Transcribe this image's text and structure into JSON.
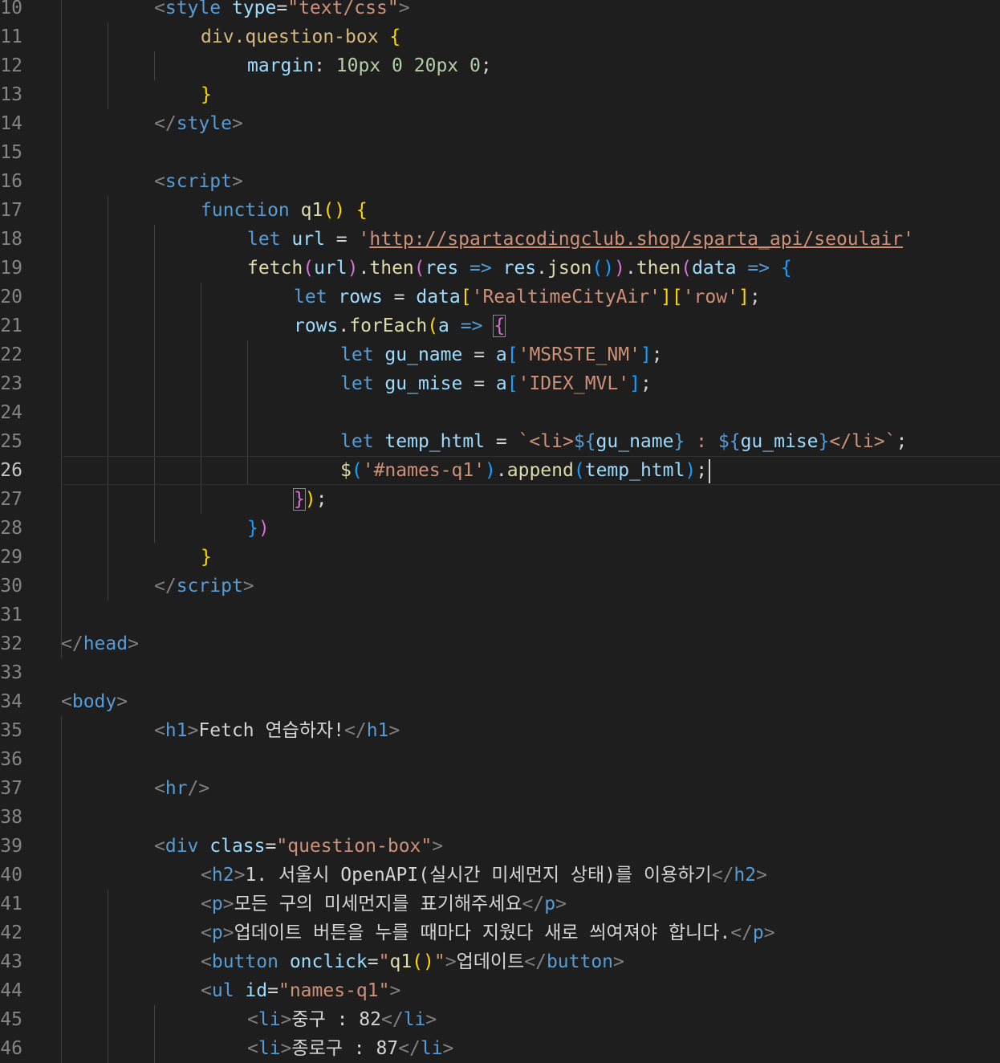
{
  "lines": [
    {
      "n": "10",
      "indent": 2,
      "tokens": [
        [
          "tagb",
          "<"
        ],
        [
          "tag",
          "style"
        ],
        [
          "txt",
          " "
        ],
        [
          "attr",
          "type"
        ],
        [
          "txt",
          "="
        ],
        [
          "str",
          "\"text/css\""
        ],
        [
          "tagb",
          ">"
        ]
      ]
    },
    {
      "n": "11",
      "indent": 3,
      "tokens": [
        [
          "css",
          "div.question-box"
        ],
        [
          "txt",
          " "
        ],
        [
          "p1",
          "{"
        ]
      ]
    },
    {
      "n": "12",
      "indent": 4,
      "tokens": [
        [
          "prop",
          "margin"
        ],
        [
          "txt",
          ": "
        ],
        [
          "num",
          "10px"
        ],
        [
          "txt",
          " "
        ],
        [
          "num",
          "0"
        ],
        [
          "txt",
          " "
        ],
        [
          "num",
          "20px"
        ],
        [
          "txt",
          " "
        ],
        [
          "num",
          "0"
        ],
        [
          "txt",
          ";"
        ]
      ]
    },
    {
      "n": "13",
      "indent": 3,
      "tokens": [
        [
          "p1",
          "}"
        ]
      ]
    },
    {
      "n": "14",
      "indent": 2,
      "tokens": [
        [
          "tagb",
          "</"
        ],
        [
          "tag",
          "style"
        ],
        [
          "tagb",
          ">"
        ]
      ]
    },
    {
      "n": "15",
      "indent": 0,
      "tokens": []
    },
    {
      "n": "16",
      "indent": 2,
      "tokens": [
        [
          "tagb",
          "<"
        ],
        [
          "tag",
          "script"
        ],
        [
          "tagb",
          ">"
        ]
      ]
    },
    {
      "n": "17",
      "indent": 3,
      "tokens": [
        [
          "kw",
          "function"
        ],
        [
          "txt",
          " "
        ],
        [
          "func",
          "q1"
        ],
        [
          "p1",
          "()"
        ],
        [
          "txt",
          " "
        ],
        [
          "p1",
          "{"
        ]
      ]
    },
    {
      "n": "18",
      "indent": 4,
      "tokens": [
        [
          "kw",
          "let"
        ],
        [
          "txt",
          " "
        ],
        [
          "var",
          "url"
        ],
        [
          "txt",
          " = "
        ],
        [
          "str",
          "'"
        ],
        [
          "strlink",
          "http://spartacodingclub.shop/sparta_api/seoulair"
        ],
        [
          "str",
          "'"
        ]
      ]
    },
    {
      "n": "19",
      "indent": 4,
      "tokens": [
        [
          "func",
          "fetch"
        ],
        [
          "p2",
          "("
        ],
        [
          "var",
          "url"
        ],
        [
          "p2",
          ")"
        ],
        [
          "txt",
          "."
        ],
        [
          "func",
          "then"
        ],
        [
          "p2",
          "("
        ],
        [
          "var",
          "res"
        ],
        [
          "txt",
          " "
        ],
        [
          "kw",
          "=>"
        ],
        [
          "txt",
          " "
        ],
        [
          "var",
          "res"
        ],
        [
          "txt",
          "."
        ],
        [
          "func",
          "json"
        ],
        [
          "p3",
          "()"
        ],
        [
          "p2",
          ")"
        ],
        [
          "txt",
          "."
        ],
        [
          "func",
          "then"
        ],
        [
          "p2",
          "("
        ],
        [
          "var",
          "data"
        ],
        [
          "txt",
          " "
        ],
        [
          "kw",
          "=>"
        ],
        [
          "txt",
          " "
        ],
        [
          "p3",
          "{"
        ]
      ]
    },
    {
      "n": "20",
      "indent": 5,
      "tokens": [
        [
          "kw",
          "let"
        ],
        [
          "txt",
          " "
        ],
        [
          "var",
          "rows"
        ],
        [
          "txt",
          " = "
        ],
        [
          "var",
          "data"
        ],
        [
          "p1",
          "["
        ],
        [
          "str",
          "'RealtimeCityAir'"
        ],
        [
          "p1",
          "]["
        ],
        [
          "str",
          "'row'"
        ],
        [
          "p1",
          "]"
        ],
        [
          "txt",
          ";"
        ]
      ]
    },
    {
      "n": "21",
      "indent": 5,
      "tokens": [
        [
          "var",
          "rows"
        ],
        [
          "txt",
          "."
        ],
        [
          "func",
          "forEach"
        ],
        [
          "p1",
          "("
        ],
        [
          "var",
          "a"
        ],
        [
          "txt",
          " "
        ],
        [
          "kw",
          "=>"
        ],
        [
          "txt",
          " "
        ],
        [
          "p2bm",
          "{"
        ]
      ]
    },
    {
      "n": "22",
      "indent": 6,
      "tokens": [
        [
          "kw",
          "let"
        ],
        [
          "txt",
          " "
        ],
        [
          "var",
          "gu_name"
        ],
        [
          "txt",
          " = "
        ],
        [
          "var",
          "a"
        ],
        [
          "p3",
          "["
        ],
        [
          "str",
          "'MSRSTE_NM'"
        ],
        [
          "p3",
          "]"
        ],
        [
          "txt",
          ";"
        ]
      ]
    },
    {
      "n": "23",
      "indent": 6,
      "tokens": [
        [
          "kw",
          "let"
        ],
        [
          "txt",
          " "
        ],
        [
          "var",
          "gu_mise"
        ],
        [
          "txt",
          " = "
        ],
        [
          "var",
          "a"
        ],
        [
          "p3",
          "["
        ],
        [
          "str",
          "'IDEX_MVL'"
        ],
        [
          "p3",
          "]"
        ],
        [
          "txt",
          ";"
        ]
      ]
    },
    {
      "n": "24",
      "indent": 0,
      "tokens": []
    },
    {
      "n": "25",
      "indent": 6,
      "tokens": [
        [
          "kw",
          "let"
        ],
        [
          "txt",
          " "
        ],
        [
          "var",
          "temp_html"
        ],
        [
          "txt",
          " = "
        ],
        [
          "str",
          "`<li>"
        ],
        [
          "kw",
          "${"
        ],
        [
          "var",
          "gu_name"
        ],
        [
          "kw",
          "}"
        ],
        [
          "str",
          " : "
        ],
        [
          "kw",
          "${"
        ],
        [
          "var",
          "gu_mise"
        ],
        [
          "kw",
          "}"
        ],
        [
          "str",
          "</li>`"
        ],
        [
          "txt",
          ";"
        ]
      ]
    },
    {
      "n": "26",
      "indent": 6,
      "current": true,
      "tokens": [
        [
          "func",
          "$"
        ],
        [
          "p3",
          "("
        ],
        [
          "str",
          "'#names-q1'"
        ],
        [
          "p3",
          ")"
        ],
        [
          "txt",
          "."
        ],
        [
          "func",
          "append"
        ],
        [
          "p3",
          "("
        ],
        [
          "var",
          "temp_html"
        ],
        [
          "p3",
          ")"
        ],
        [
          "txt",
          ";"
        ]
      ]
    },
    {
      "n": "27",
      "indent": 5,
      "tokens": [
        [
          "p2bm",
          "}"
        ],
        [
          "p1",
          ")"
        ],
        [
          "txt",
          ";"
        ]
      ]
    },
    {
      "n": "28",
      "indent": 4,
      "tokens": [
        [
          "p3",
          "}"
        ],
        [
          "p2",
          ")"
        ]
      ]
    },
    {
      "n": "29",
      "indent": 3,
      "tokens": [
        [
          "p1",
          "}"
        ]
      ]
    },
    {
      "n": "30",
      "indent": 2,
      "tokens": [
        [
          "tagb",
          "</"
        ],
        [
          "tag",
          "script"
        ],
        [
          "tagb",
          ">"
        ]
      ]
    },
    {
      "n": "31",
      "indent": 0,
      "tokens": []
    },
    {
      "n": "32",
      "indent": 0,
      "tokens": [
        [
          "tagb",
          "</"
        ],
        [
          "tag",
          "head"
        ],
        [
          "tagb",
          ">"
        ]
      ]
    },
    {
      "n": "33",
      "indent": 0,
      "tokens": []
    },
    {
      "n": "34",
      "indent": 0,
      "tokens": [
        [
          "tagb",
          "<"
        ],
        [
          "tag",
          "body"
        ],
        [
          "tagb",
          ">"
        ]
      ]
    },
    {
      "n": "35",
      "indent": 2,
      "tokens": [
        [
          "tagb",
          "<"
        ],
        [
          "tag",
          "h1"
        ],
        [
          "tagb",
          ">"
        ],
        [
          "txt",
          "Fetch 연습하자!"
        ],
        [
          "tagb",
          "</"
        ],
        [
          "tag",
          "h1"
        ],
        [
          "tagb",
          ">"
        ]
      ]
    },
    {
      "n": "36",
      "indent": 0,
      "tokens": []
    },
    {
      "n": "37",
      "indent": 2,
      "tokens": [
        [
          "tagb",
          "<"
        ],
        [
          "tag",
          "hr"
        ],
        [
          "tagb",
          "/>"
        ]
      ]
    },
    {
      "n": "38",
      "indent": 0,
      "tokens": []
    },
    {
      "n": "39",
      "indent": 2,
      "tokens": [
        [
          "tagb",
          "<"
        ],
        [
          "tag",
          "div"
        ],
        [
          "txt",
          " "
        ],
        [
          "attr",
          "class"
        ],
        [
          "txt",
          "="
        ],
        [
          "str",
          "\"question-box\""
        ],
        [
          "tagb",
          ">"
        ]
      ]
    },
    {
      "n": "40",
      "indent": 3,
      "tokens": [
        [
          "tagb",
          "<"
        ],
        [
          "tag",
          "h2"
        ],
        [
          "tagb",
          ">"
        ],
        [
          "txt",
          "1. 서울시 OpenAPI(실시간 미세먼지 상태)를 이용하기"
        ],
        [
          "tagb",
          "</"
        ],
        [
          "tag",
          "h2"
        ],
        [
          "tagb",
          ">"
        ]
      ]
    },
    {
      "n": "41",
      "indent": 3,
      "tokens": [
        [
          "tagb",
          "<"
        ],
        [
          "tag",
          "p"
        ],
        [
          "tagb",
          ">"
        ],
        [
          "txt",
          "모든 구의 미세먼지를 표기해주세요"
        ],
        [
          "tagb",
          "</"
        ],
        [
          "tag",
          "p"
        ],
        [
          "tagb",
          ">"
        ]
      ]
    },
    {
      "n": "42",
      "indent": 3,
      "tokens": [
        [
          "tagb",
          "<"
        ],
        [
          "tag",
          "p"
        ],
        [
          "tagb",
          ">"
        ],
        [
          "txt",
          "업데이트 버튼을 누를 때마다 지웠다 새로 씌여져야 합니다."
        ],
        [
          "tagb",
          "</"
        ],
        [
          "tag",
          "p"
        ],
        [
          "tagb",
          ">"
        ]
      ]
    },
    {
      "n": "43",
      "indent": 3,
      "tokens": [
        [
          "tagb",
          "<"
        ],
        [
          "tag",
          "button"
        ],
        [
          "txt",
          " "
        ],
        [
          "attr",
          "onclick"
        ],
        [
          "txt",
          "="
        ],
        [
          "str",
          "\""
        ],
        [
          "func",
          "q1"
        ],
        [
          "p1",
          "()"
        ],
        [
          "str",
          "\""
        ],
        [
          "tagb",
          ">"
        ],
        [
          "txt",
          "업데이트"
        ],
        [
          "tagb",
          "</"
        ],
        [
          "tag",
          "button"
        ],
        [
          "tagb",
          ">"
        ]
      ]
    },
    {
      "n": "44",
      "indent": 3,
      "tokens": [
        [
          "tagb",
          "<"
        ],
        [
          "tag",
          "ul"
        ],
        [
          "txt",
          " "
        ],
        [
          "attr",
          "id"
        ],
        [
          "txt",
          "="
        ],
        [
          "str",
          "\"names-q1\""
        ],
        [
          "tagb",
          ">"
        ]
      ]
    },
    {
      "n": "45",
      "indent": 4,
      "tokens": [
        [
          "tagb",
          "<"
        ],
        [
          "tag",
          "li"
        ],
        [
          "tagb",
          ">"
        ],
        [
          "txt",
          "중구 : 82"
        ],
        [
          "tagb",
          "</"
        ],
        [
          "tag",
          "li"
        ],
        [
          "tagb",
          ">"
        ]
      ]
    },
    {
      "n": "46",
      "indent": 4,
      "tokens": [
        [
          "tagb",
          "<"
        ],
        [
          "tag",
          "li"
        ],
        [
          "tagb",
          ">"
        ],
        [
          "txt",
          "종로구 : 87"
        ],
        [
          "tagb",
          "</"
        ],
        [
          "tag",
          "li"
        ],
        [
          "tagb",
          ">"
        ]
      ]
    }
  ]
}
